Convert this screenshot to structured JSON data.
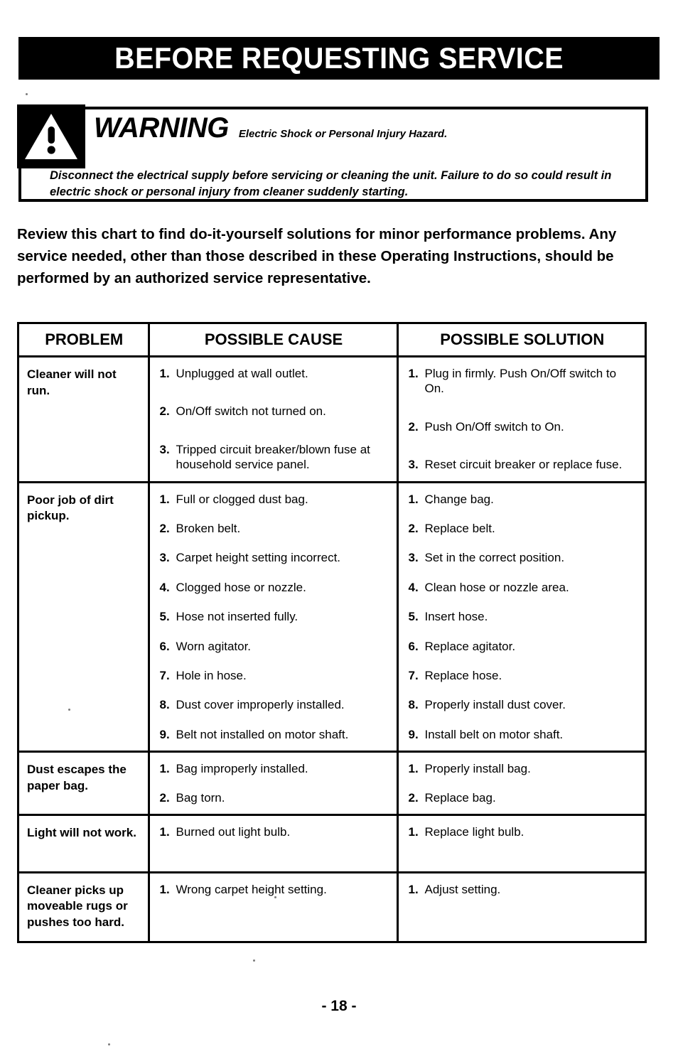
{
  "header": {
    "title": "BEFORE REQUESTING SERVICE"
  },
  "warning": {
    "icon": "warning-triangle-icon",
    "word": "WARNING",
    "subtitle": "Electric Shock or Personal Injury Hazard.",
    "body": "Disconnect the electrical supply before servicing or cleaning the unit.  Failure to do so could result in electric shock or personal injury from cleaner suddenly starting."
  },
  "intro": {
    "text": "Review this chart to find do-it-yourself solutions for minor performance problems.  Any service needed, other than those described in these Operating Instructions, should be performed by an authorized service representative."
  },
  "table": {
    "headers": {
      "problem": "PROBLEM",
      "cause": "POSSIBLE CAUSE",
      "solution": "POSSIBLE SOLUTION"
    },
    "rows": [
      {
        "problem": "Cleaner will not run.",
        "causes": [
          {
            "num": "1.",
            "text": "Unplugged at wall outlet."
          },
          {
            "num": "2.",
            "text": "On/Off switch not turned on."
          },
          {
            "num": "3.",
            "text": "Tripped circuit breaker/blown fuse at household service panel."
          }
        ],
        "solutions": [
          {
            "num": "1.",
            "text": "Plug in firmly.  Push On/Off switch to On."
          },
          {
            "num": "2.",
            "text": "Push On/Off switch to On."
          },
          {
            "num": "3.",
            "text": "Reset circuit breaker or replace fuse."
          }
        ]
      },
      {
        "problem": "Poor job of dirt pickup.",
        "causes": [
          {
            "num": "1.",
            "text": "Full or clogged dust bag."
          },
          {
            "num": "2.",
            "text": "Broken belt."
          },
          {
            "num": "3.",
            "text": "Carpet height setting incorrect."
          },
          {
            "num": "4.",
            "text": "Clogged hose or nozzle."
          },
          {
            "num": "5.",
            "text": "Hose not inserted fully."
          },
          {
            "num": "6.",
            "text": "Worn agitator."
          },
          {
            "num": "7.",
            "text": "Hole in hose."
          },
          {
            "num": "8.",
            "text": "Dust cover improperly installed."
          },
          {
            "num": "9.",
            "text": "Belt not installed on motor shaft."
          }
        ],
        "solutions": [
          {
            "num": "1.",
            "text": "Change bag."
          },
          {
            "num": "2.",
            "text": "Replace belt."
          },
          {
            "num": "3.",
            "text": "Set in the correct position."
          },
          {
            "num": "4.",
            "text": "Clean hose or nozzle area."
          },
          {
            "num": "5.",
            "text": "Insert hose."
          },
          {
            "num": "6.",
            "text": "Replace agitator."
          },
          {
            "num": "7.",
            "text": "Replace hose."
          },
          {
            "num": "8.",
            "text": "Properly install dust cover."
          },
          {
            "num": "9.",
            "text": "Install belt on motor shaft."
          }
        ]
      },
      {
        "problem": "Dust escapes the paper bag.",
        "causes": [
          {
            "num": "1.",
            "text": "Bag improperly installed."
          },
          {
            "num": "2.",
            "text": "Bag torn."
          }
        ],
        "solutions": [
          {
            "num": "1.",
            "text": "Properly install bag."
          },
          {
            "num": "2.",
            "text": "Replace bag."
          }
        ]
      },
      {
        "problem": "Light will not work.",
        "causes": [
          {
            "num": "1.",
            "text": "Burned out light bulb."
          }
        ],
        "solutions": [
          {
            "num": "1.",
            "text": "Replace light bulb."
          }
        ]
      },
      {
        "problem": "Cleaner picks up moveable rugs or pushes too hard.",
        "causes": [
          {
            "num": "1.",
            "text": "Wrong carpet height setting."
          }
        ],
        "solutions": [
          {
            "num": "1.",
            "text": "Adjust setting."
          }
        ]
      }
    ]
  },
  "footer": {
    "page_number": "- 18 -"
  },
  "colors": {
    "ink": "#000000",
    "paper": "#ffffff"
  }
}
